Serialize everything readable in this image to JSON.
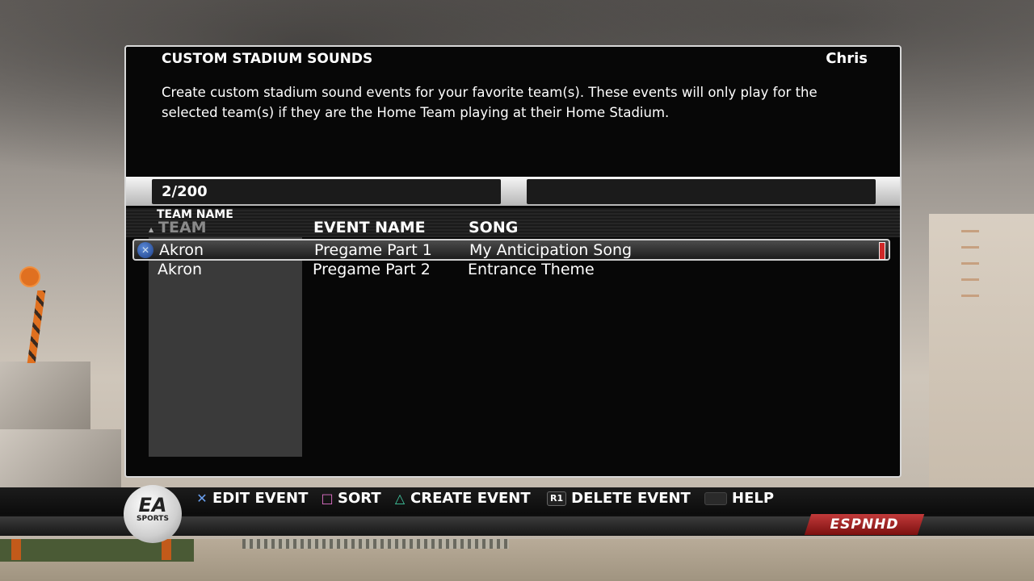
{
  "header": {
    "title": "CUSTOM STADIUM SOUNDS",
    "user": "Chris",
    "description": "Create custom stadium sound events for your favorite team(s). These events will only play for the selected team(s) if they are the Home Team playing at their Home Stadium."
  },
  "counter": "2/200",
  "table": {
    "sort_label": "TEAM NAME",
    "columns": {
      "team": "TEAM",
      "event": "EVENT NAME",
      "song": "SONG"
    },
    "rows": [
      {
        "team": "Akron",
        "event": "Pregame Part 1",
        "song": "My Anticipation Song",
        "selected": true
      },
      {
        "team": "Akron",
        "event": "Pregame Part 2",
        "song": "Entrance Theme",
        "selected": false
      }
    ]
  },
  "controls": [
    {
      "icon": "cross-button-icon",
      "label": "EDIT EVENT"
    },
    {
      "icon": "square-button-icon",
      "label": "SORT"
    },
    {
      "icon": "triangle-button-icon",
      "label": "CREATE EVENT"
    },
    {
      "icon": "r1-button-icon",
      "glyph": "R1",
      "label": "DELETE EVENT"
    },
    {
      "icon": "select-button-icon",
      "label": "HELP"
    }
  ],
  "branding": {
    "ea_logo": "EA",
    "ea_sub": "SPORTS",
    "network": "ESPNHD"
  }
}
